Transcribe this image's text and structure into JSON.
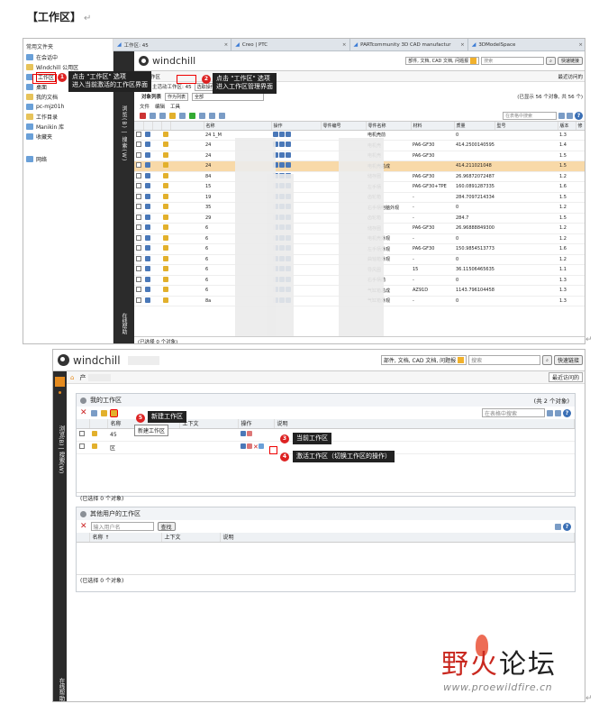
{
  "doc": {
    "heading": "【工作区】",
    "return_mark": "↵"
  },
  "shot1": {
    "tree_title": "常用文件夹",
    "tree": [
      {
        "label": "在会话中",
        "type": "item"
      },
      {
        "label": "Windchill 公用区",
        "type": "folder"
      },
      {
        "label": "工作区",
        "type": "item",
        "selected": true
      },
      {
        "label": "桌面",
        "type": "item"
      },
      {
        "label": "我的文档",
        "type": "folder"
      },
      {
        "label": "pc-mjz01h",
        "type": "item"
      },
      {
        "label": "工作目录",
        "type": "folder"
      },
      {
        "label": "Manikin 库",
        "type": "item"
      },
      {
        "label": "收藏夹",
        "type": "item"
      },
      {
        "label": "网络",
        "type": "item"
      }
    ],
    "tabs": [
      {
        "label": "工作区: 45"
      },
      {
        "label": "Creo | PTC"
      },
      {
        "label": "PARTcommunity 3D CAD manufactur"
      },
      {
        "label": "3DModelSpace"
      }
    ],
    "logo": "windchill",
    "search_type": "部件, 文档, CAD 文档, 问题报",
    "search_placeholder": "搜索",
    "quick_link": "快速链接",
    "recent": "最近访问的",
    "crumb": "工作区",
    "ws_label": "主活动工作区: 45",
    "ws_action": "选取操作",
    "obj_list": "对象列表",
    "obj_filter": "作为列表",
    "obj_all": "全部",
    "shown_count": "(已显示 56 个对象, 共 56 个)",
    "menus": [
      "文件",
      "编辑",
      "工具"
    ],
    "table_search_placeholder": "在表格中搜索",
    "side_vertical": "浏览(B) | 搜索(W)",
    "side_bottom": "在线帮助",
    "columns": [
      "",
      "",
      "",
      "",
      "",
      "名称",
      "操作",
      "零件编号",
      "零件名称",
      "材料",
      "质量",
      "型号",
      "版本",
      "修"
    ],
    "rows": [
      {
        "pre": "24",
        "suf": "1_M",
        "partname": "电机壳前",
        "material": "",
        "mass": "0",
        "version": "1.3"
      },
      {
        "pre": "24",
        "suf": "",
        "partname": "电机壳",
        "material": "PA6-GF30",
        "mass": "414.25001405955",
        "version": "1.4"
      },
      {
        "pre": "24",
        "suf": "",
        "partname": "电机壳",
        "material": "PA6-GF30",
        "mass": "",
        "version": "1.5"
      },
      {
        "pre": "24",
        "suf": "",
        "partname": "电机壳总成",
        "material": "",
        "mass": "414.211021048",
        "version": "1.5",
        "highlight": true
      },
      {
        "pre": "84",
        "suf": "",
        "partname": "储存圈",
        "material": "PA6-GF30",
        "mass": "26.968720724875",
        "version": "1.2"
      },
      {
        "pre": "15",
        "suf": "",
        "partname": "左手柄",
        "material": "PA6-GF30+TPE",
        "mass": "160.08912873353",
        "version": "1.6"
      },
      {
        "pre": "19",
        "suf": "",
        "partname": "齿轮箱",
        "material": "-",
        "mass": "284.70972143346",
        "version": "1.5"
      },
      {
        "pre": "35",
        "suf": "",
        "partname": "右手柄电脑外观",
        "material": "-",
        "mass": "0",
        "version": "1.2"
      },
      {
        "pre": "29",
        "suf": "",
        "partname": "齿轮箱",
        "material": "-",
        "mass": "284.7",
        "version": "1.5"
      },
      {
        "pre": "6",
        "suf": "",
        "partname": "储存圈",
        "material": "PA6-GF30",
        "mass": "26.968888493003",
        "version": "1.2"
      },
      {
        "pre": "6",
        "suf": "",
        "partname": "电机壳外观",
        "material": "-",
        "mass": "0",
        "version": "1.2"
      },
      {
        "pre": "6",
        "suf": "",
        "partname": "左手柄外观",
        "material": "PA6-GF30",
        "mass": "150.98545137738",
        "version": "1.6"
      },
      {
        "pre": "6",
        "suf": "",
        "partname": "曲轴箱外观",
        "material": "-",
        "mass": "0",
        "version": "1.2"
      },
      {
        "pre": "6",
        "suf": "",
        "partname": "导风圈",
        "material": "15",
        "mass": "36.11506465635",
        "version": "1.1"
      },
      {
        "pre": "6",
        "suf": "",
        "partname": "右手柄前",
        "material": "-",
        "mass": "0",
        "version": "1.3"
      },
      {
        "pre": "6",
        "suf": "",
        "partname": "气缸箱总成",
        "material": "AZ91D",
        "mass": "1143.7961044582",
        "version": "1.3"
      },
      {
        "pre": "8a",
        "suf": "",
        "partname": "气缸箱外观",
        "material": "-",
        "mass": "0",
        "version": "1.3"
      }
    ],
    "footer": "(已选择 0 个对象)",
    "callout1_num": "1",
    "callout1_line1": "点击 \"工作区\" 选项",
    "callout1_line2": "进入当前激活的工作区界面",
    "callout2_num": "2",
    "callout2_line1": "点击 \"工作区\" 选项",
    "callout2_line2": "进入工作区管理界面"
  },
  "shot2": {
    "logo": "windchill",
    "search_type": "部件, 文档, CAD 文档, 问题报",
    "search_placeholder": "搜索",
    "quick_link": "快速链接",
    "crumb": "产",
    "recent": "最近访问的",
    "side_vertical": "浏览(B) | 搜索(W)",
    "side_bottom": "在线帮助",
    "my_ws_title": "我的工作区",
    "my_ws_count": "(共 2 个对象)",
    "table_search_placeholder": "在表格中搜索",
    "new_ws_tooltip": "新建工作区",
    "my_ws_columns": [
      "",
      "",
      "名称",
      "上下文",
      "操作",
      "说明"
    ],
    "my_ws_rows": [
      {
        "name": "45",
        "context": ""
      },
      {
        "name": "区",
        "context": ""
      }
    ],
    "my_ws_footer": "(已选择 0 个对象)",
    "other_ws_title": "其他用户的工作区",
    "user_placeholder": "输入用户名",
    "find": "查找",
    "other_columns": [
      "",
      "名称 ↑",
      "上下文",
      "说明"
    ],
    "other_footer": "(已选择 0 个对象)",
    "callout3_num": "3",
    "callout3_text": "当前工作区",
    "callout4_num": "4",
    "callout4_text": "激活工作区（切换工作区的操作）",
    "callout5_num": "5",
    "callout5_text": "新建工作区"
  },
  "watermark": {
    "line1_a": "野火",
    "line1_b": "论坛",
    "url": "www.proewildfire.cn"
  },
  "colors": {
    "accent_orange": "#e58b1f",
    "callout_bg": "#222222",
    "badge_red": "#d22222",
    "highlight_row": "#f8d9a8"
  }
}
